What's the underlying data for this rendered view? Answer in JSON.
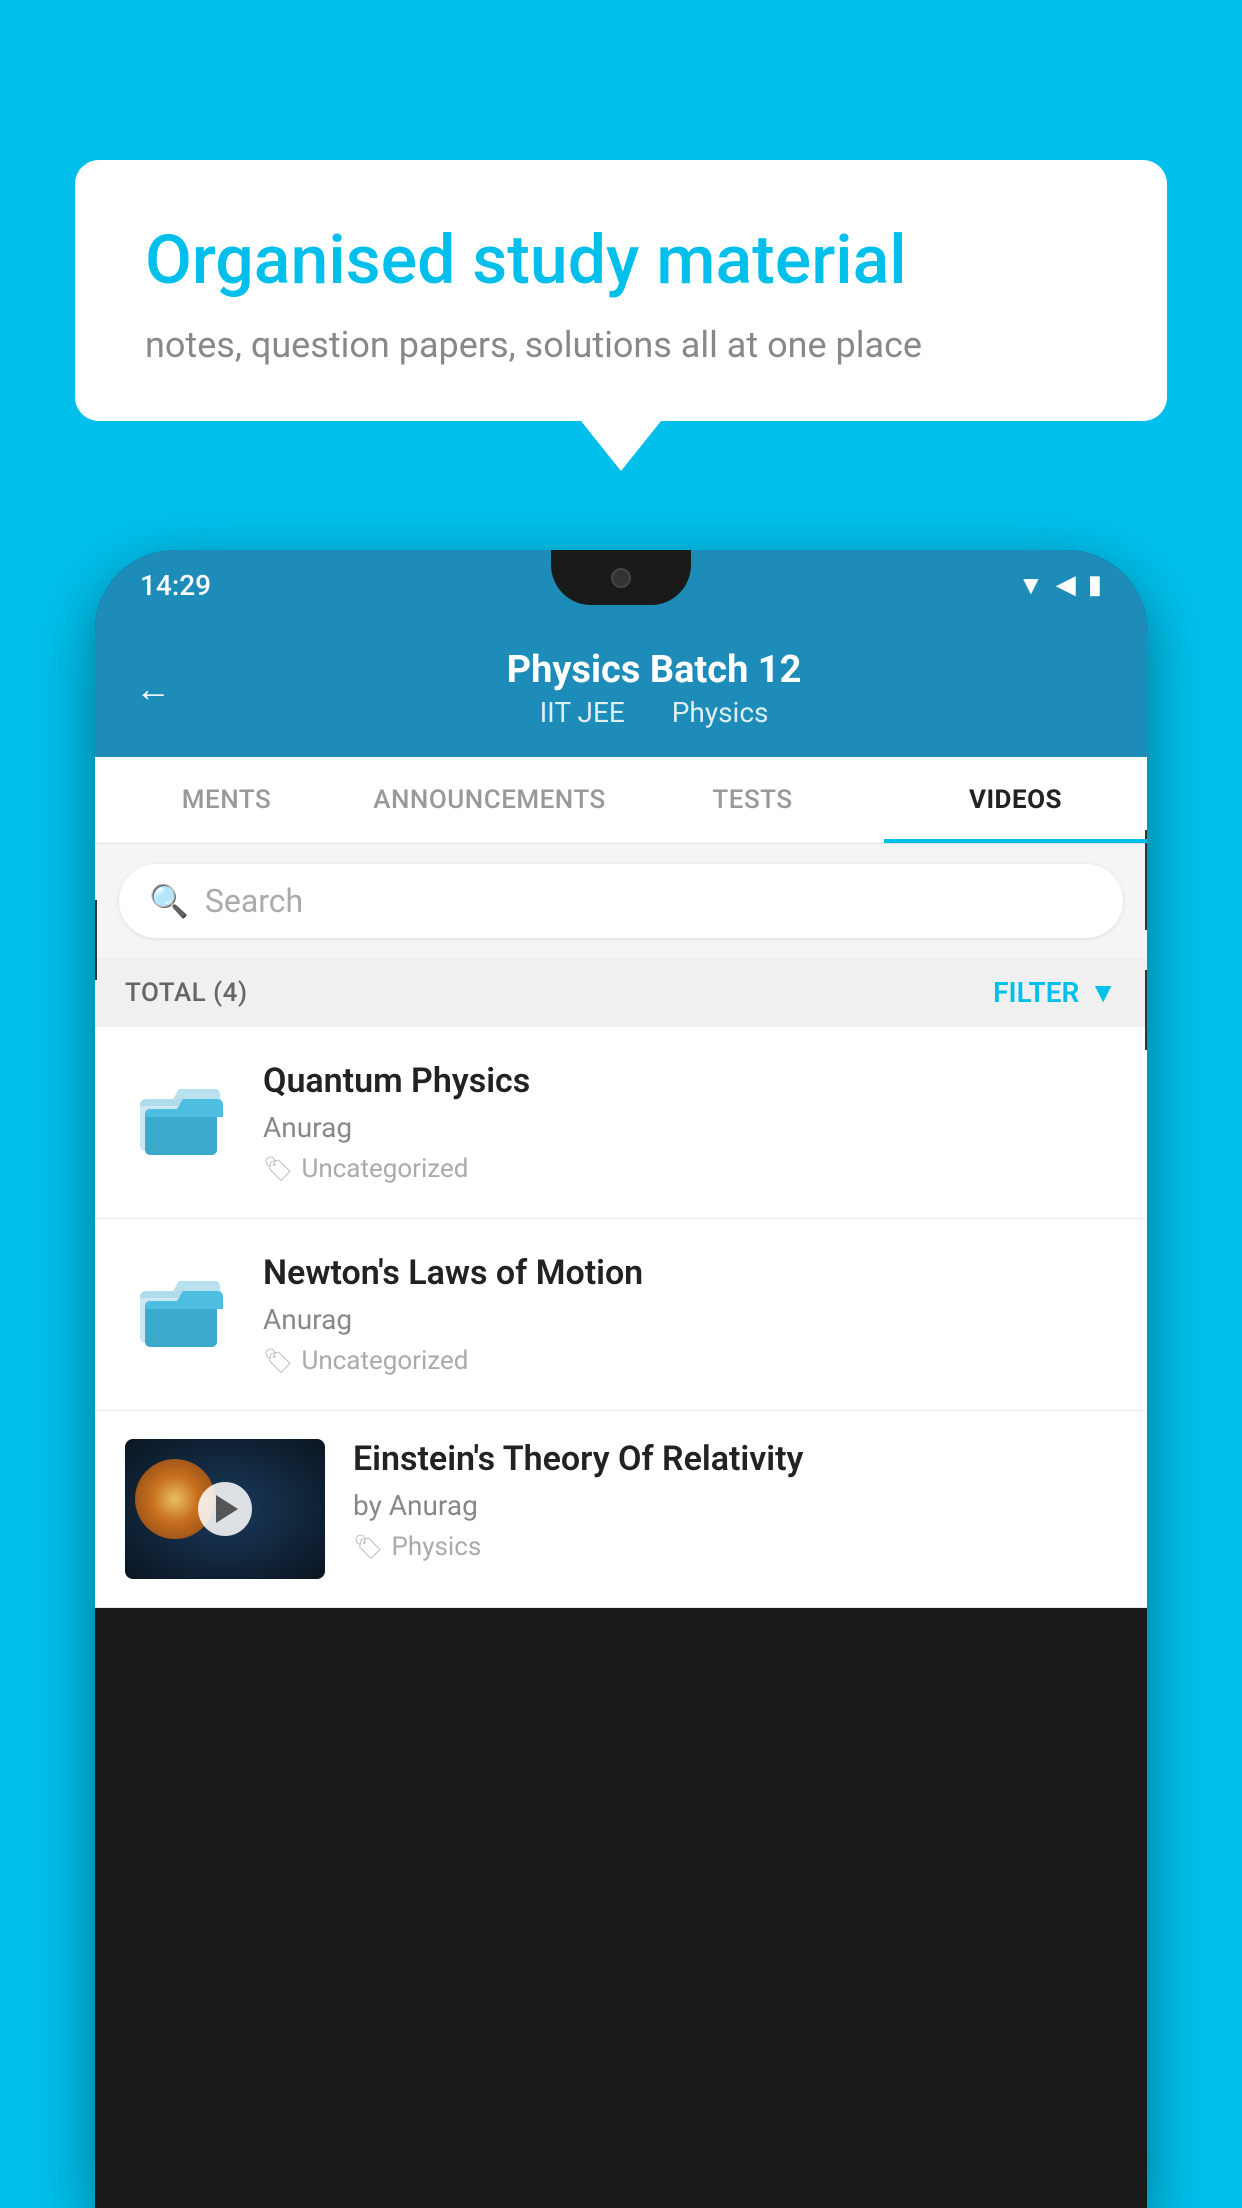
{
  "bubble": {
    "title": "Organised study material",
    "subtitle": "notes, question papers, solutions all at one place"
  },
  "header": {
    "title": "Physics Batch 12",
    "subtitle1": "IIT JEE",
    "subtitle2": "Physics"
  },
  "tabs": [
    {
      "label": "MENTS",
      "active": false
    },
    {
      "label": "ANNOUNCEMENTS",
      "active": false
    },
    {
      "label": "TESTS",
      "active": false
    },
    {
      "label": "VIDEOS",
      "active": true
    }
  ],
  "search": {
    "placeholder": "Search"
  },
  "filter": {
    "total_label": "TOTAL (4)",
    "filter_label": "FILTER"
  },
  "videos": [
    {
      "title": "Quantum Physics",
      "author": "Anurag",
      "tag": "Uncategorized",
      "has_thumb": false
    },
    {
      "title": "Newton's Laws of Motion",
      "author": "Anurag",
      "tag": "Uncategorized",
      "has_thumb": false
    },
    {
      "title": "Einstein's Theory Of Relativity",
      "author": "by Anurag",
      "tag": "Physics",
      "has_thumb": true
    }
  ],
  "status_bar": {
    "time": "14:29"
  }
}
